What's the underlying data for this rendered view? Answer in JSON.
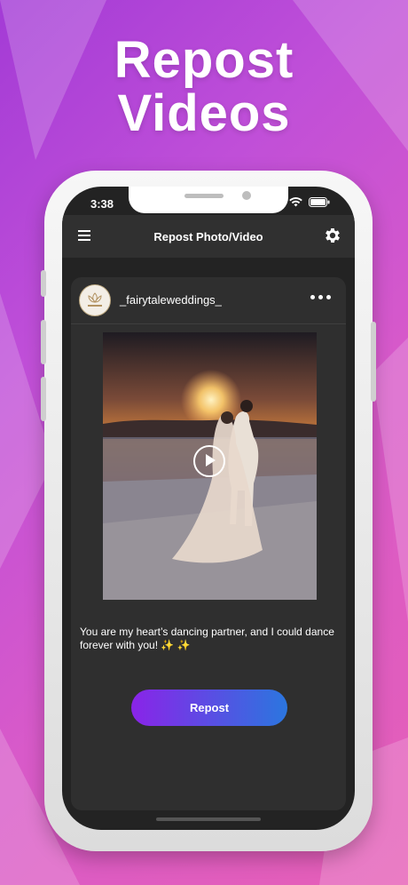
{
  "headline": {
    "line1": "Repost",
    "line2": "Videos"
  },
  "status_bar": {
    "time": "3:38"
  },
  "app_bar": {
    "title": "Repost Photo/Video"
  },
  "post": {
    "username": "_fairytaleweddings_",
    "caption": "You are my heart’s dancing partner, and I could dance forever with you! ✨ ✨"
  },
  "actions": {
    "repost_label": "Repost"
  },
  "colors": {
    "background": "#c04fd8",
    "screen": "#232323",
    "appbar": "#303030",
    "card": "#2f2f2f",
    "button_start": "#8a24e8",
    "button_end": "#2b76df"
  },
  "icons": [
    "menu-icon",
    "gear-icon",
    "more-icon",
    "play-icon",
    "wifi-icon",
    "battery-icon"
  ]
}
